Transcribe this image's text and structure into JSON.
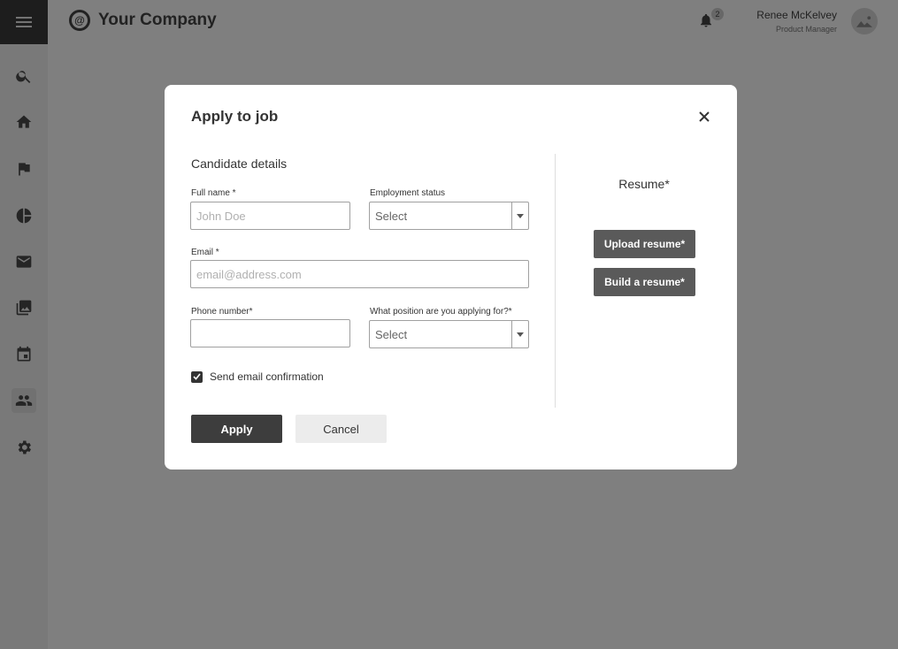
{
  "app": {
    "brand_symbol": "@",
    "brand_name": "Your Company",
    "notifications_count": "2",
    "user_name": "Renee McKelvey",
    "user_role": "Product Manager"
  },
  "sidebar": {
    "items": [
      {
        "icon": "search-icon"
      },
      {
        "icon": "home-icon"
      },
      {
        "icon": "flag-icon"
      },
      {
        "icon": "pie-chart-icon"
      },
      {
        "icon": "mail-icon"
      },
      {
        "icon": "gallery-icon"
      },
      {
        "icon": "calendar-icon"
      },
      {
        "icon": "people-icon",
        "active": true
      },
      {
        "icon": "gear-icon"
      }
    ]
  },
  "modal": {
    "title": "Apply to job",
    "section_title": "Candidate details",
    "full_name": {
      "label": "Full name *",
      "placeholder": "John Doe",
      "value": ""
    },
    "employment_status": {
      "label": "Employment status",
      "value": "Select"
    },
    "email": {
      "label": "Email *",
      "placeholder": "email@address.com",
      "value": ""
    },
    "phone": {
      "label": "Phone number*",
      "placeholder": "",
      "value": ""
    },
    "position": {
      "label": "What position are you applying for?*",
      "value": "Select"
    },
    "send_confirmation": {
      "label": "Send email confirmation",
      "checked": true
    },
    "apply_label": "Apply",
    "cancel_label": "Cancel",
    "resume_label": "Resume*",
    "upload_resume_label": "Upload resume*",
    "build_resume_label": "Build a resume*"
  }
}
